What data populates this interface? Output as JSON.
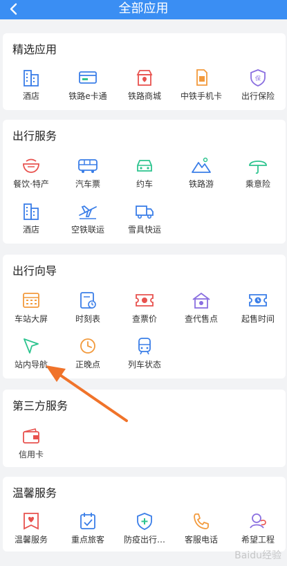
{
  "header": {
    "title": "全部应用"
  },
  "sections": [
    {
      "title": "精选应用",
      "items": [
        {
          "label": "酒店",
          "icon": "hotel-icon"
        },
        {
          "label": "铁路e卡通",
          "icon": "ecard-icon"
        },
        {
          "label": "铁路商城",
          "icon": "shop-icon"
        },
        {
          "label": "中铁手机卡",
          "icon": "sim-card-icon"
        },
        {
          "label": "出行保险",
          "icon": "insurance-icon"
        }
      ]
    },
    {
      "title": "出行服务",
      "items": [
        {
          "label": "餐饮·特产",
          "icon": "food-icon"
        },
        {
          "label": "汽车票",
          "icon": "bus-icon"
        },
        {
          "label": "约车",
          "icon": "car-icon"
        },
        {
          "label": "铁路游",
          "icon": "mountain-icon"
        },
        {
          "label": "乘意险",
          "icon": "umbrella-icon"
        },
        {
          "label": "酒店",
          "icon": "hotel-icon"
        },
        {
          "label": "空铁联运",
          "icon": "plane-icon"
        },
        {
          "label": "雪具快运",
          "icon": "truck-icon"
        }
      ]
    },
    {
      "title": "出行向导",
      "items": [
        {
          "label": "车站大屏",
          "icon": "screen-icon"
        },
        {
          "label": "时刻表",
          "icon": "timetable-icon"
        },
        {
          "label": "查票价",
          "icon": "ticket-price-icon"
        },
        {
          "label": "查代售点",
          "icon": "agency-icon"
        },
        {
          "label": "起售时间",
          "icon": "sale-time-icon"
        },
        {
          "label": "站内导航",
          "icon": "navigation-icon"
        },
        {
          "label": "正晚点",
          "icon": "clock-icon"
        },
        {
          "label": "列车状态",
          "icon": "train-icon"
        }
      ]
    },
    {
      "title": "第三方服务",
      "items": [
        {
          "label": "信用卡",
          "icon": "wallet-icon"
        }
      ]
    },
    {
      "title": "温馨服务",
      "items": [
        {
          "label": "温馨服务",
          "icon": "heart-icon"
        },
        {
          "label": "重点旅客",
          "icon": "calendar-check-icon"
        },
        {
          "label": "防疫出行…",
          "icon": "shield-plus-icon"
        },
        {
          "label": "客服电话",
          "icon": "phone-icon"
        },
        {
          "label": "希望工程",
          "icon": "hope-icon"
        }
      ]
    }
  ],
  "colors": {
    "header": "#3a8ef3",
    "blue": "#3a7ee8",
    "red": "#e8524e",
    "green": "#2dc48f",
    "orange": "#f29a3d",
    "purple": "#8a6fe0",
    "arrow": "#f0732a"
  },
  "watermark": "Baidu经验"
}
